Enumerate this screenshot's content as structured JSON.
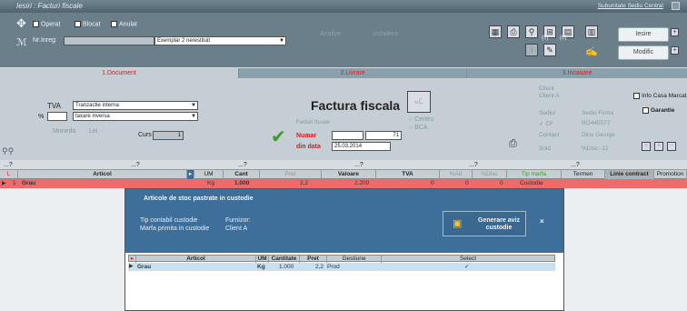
{
  "window": {
    "title": "Iesiri : Facturi fiscale",
    "right_link": "Subunitate Sediu Central"
  },
  "toolbar": {
    "operat_label": "Operat",
    "operat_checked": true,
    "blocat_label": "Blocat",
    "anulat_label": "Anulat",
    "nrinreg_label": "Nr.Inreg:",
    "nrinreg_value": "",
    "exemplar_value": "Exemplar 2 nerestituit",
    "analize_label": "Analize",
    "inchidere_label": "inchidere",
    "badge1": "(0)",
    "badge2": "(0)",
    "iesire_label": "Iesire",
    "modific_label": "Modific"
  },
  "tabs": [
    {
      "label": "1.Document",
      "active": true
    },
    {
      "label": "2.Livrare",
      "active": false
    },
    {
      "label": "3.Incasare",
      "active": false
    }
  ],
  "document": {
    "tva_label": "TVA",
    "tva_value": "Tranzactie interna",
    "percent_label": "%",
    "tva_mode_value": "taxare inversa",
    "moneda_label": "Moneda",
    "moneda_value": "Lei",
    "curs_label": "Curs",
    "curs_value": "1",
    "heading": "Factura fiscala",
    "stamp_label": "ℴℒ",
    "facturi_label": "Facturi fiscale",
    "numar_label": "Numar",
    "numar_value": "71",
    "din_data_label": "din data",
    "din_data_value": "25.03.2014",
    "centru_label": "Centru",
    "bca_label": "BCA",
    "client_label": "Client",
    "client_value": "Client A",
    "sediul_label": "Sediul",
    "sediul_value": "Sediu Firma",
    "cf_label": "CF",
    "cf_value": "RO445577",
    "contact_label": "Contact",
    "contact_value": "Dinu George",
    "sold_label": "Sold",
    "disc_label": "%Disc:-12",
    "info_casa_label": "Info Casa Marcat",
    "garantie_label": "Garantie"
  },
  "filter_row": [
    "...?",
    "...?",
    "...?",
    "...?",
    "...?",
    "...?"
  ],
  "grid": {
    "headers": [
      "L",
      "Articol",
      "UM",
      "Cant",
      "Pret",
      "Valoare",
      "TVA",
      "%Ad",
      "%Disc",
      "Tip marfa",
      "Termen",
      "Linie contract",
      "Promotion"
    ],
    "rows": [
      [
        "1",
        "Grau",
        "Kg",
        "1.000",
        "2,2",
        "2.200",
        "0",
        "0",
        "0",
        "Custodie",
        "",
        "",
        ""
      ]
    ]
  },
  "popup": {
    "title": "Articole de stoc pastrate in custodie",
    "tip_label": "Tip contabil custodie",
    "furnizor_label": "Furnizor:",
    "marfa_label": "Marfa primita in custodie",
    "furnizor_value": "Client A",
    "generate_label": "Generare aviz custodie",
    "headers": [
      "Articol",
      "UM",
      "Cantitate",
      "Pret",
      "Gestiune",
      "Select"
    ],
    "rows": [
      [
        "Grau",
        "Kg",
        "1.000",
        "2,2",
        "Prod",
        "✓"
      ]
    ]
  },
  "colors": {
    "accent_red": "#d62020",
    "row_red": "#f06a6a",
    "popup_blue": "#3e6f9a"
  }
}
